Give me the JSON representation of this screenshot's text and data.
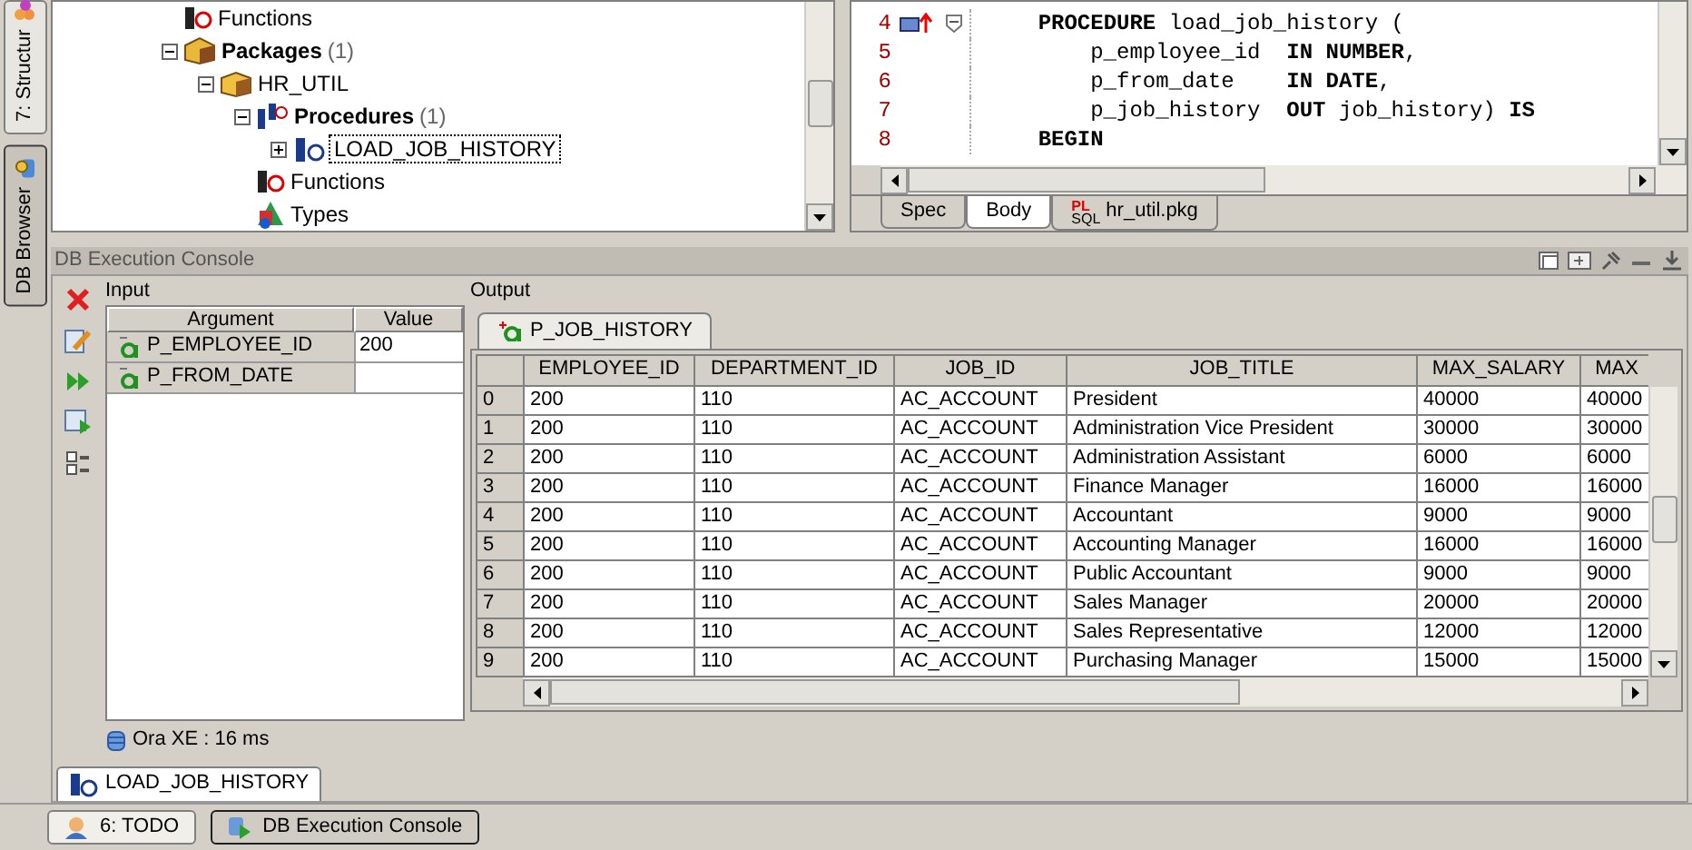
{
  "side_tabs": [
    {
      "label": "7: Structur",
      "selected": false
    },
    {
      "label": "DB Browser",
      "selected": true
    }
  ],
  "tree": [
    {
      "label": "Functions",
      "kind": "functions",
      "selected": false
    },
    {
      "label": "Packages",
      "count": "(1)",
      "kind": "folder",
      "expanded": true,
      "selected": false,
      "children": [
        {
          "label": "HR_UTIL",
          "kind": "package",
          "expanded": true,
          "selected": false,
          "children": [
            {
              "label": "Procedures",
              "count": "(1)",
              "kind": "procedures",
              "expanded": true,
              "selected": false,
              "children": [
                {
                  "label": "LOAD_JOB_HISTORY",
                  "kind": "procedure",
                  "expanded": false,
                  "selected": true
                }
              ]
            },
            {
              "label": "Functions",
              "kind": "functions",
              "selected": false
            },
            {
              "label": "Types",
              "kind": "types",
              "selected": false
            }
          ]
        }
      ]
    }
  ],
  "editor": {
    "lines": [
      {
        "number": "4",
        "marker": true,
        "fold": true,
        "code": "    **PROCEDURE** load_job_history ("
      },
      {
        "number": "5",
        "marker": false,
        "fold": false,
        "code": "        p_employee_id  **IN NUMBER**,"
      },
      {
        "number": "6",
        "marker": false,
        "fold": false,
        "code": "        p_from_date    **IN DATE**,"
      },
      {
        "number": "7",
        "marker": false,
        "fold": false,
        "code": "        p_job_history  **OUT** job_history) **IS**"
      },
      {
        "number": "8",
        "marker": false,
        "fold": false,
        "code": "    **BEGIN**"
      }
    ],
    "tabs": [
      {
        "label": "Spec",
        "selected": false
      },
      {
        "label": "Body",
        "selected": true
      },
      {
        "label": "hr_util.pkg",
        "kind": "file",
        "badge": "PL",
        "badge_sub": "SQL",
        "selected": false
      }
    ]
  },
  "console": {
    "title": "DB Execution Console",
    "input": {
      "label": "Input",
      "columns": [
        "Argument",
        "Value"
      ],
      "rows": [
        {
          "argument": "P_EMPLOYEE_ID",
          "value": "200"
        },
        {
          "argument": "P_FROM_DATE"
        }
      ]
    },
    "output": {
      "label": "Output",
      "tabs": [
        {
          "label": "P_JOB_HISTORY",
          "selected": true
        }
      ],
      "columns": [
        "EMPLOYEE_ID",
        "DEPARTMENT_ID",
        "JOB_ID",
        "JOB_TITLE",
        "MAX_SALARY",
        "MAX"
      ],
      "rows": [
        {
          "index": "0",
          "cells": [
            "200",
            "110",
            "AC_ACCOUNT",
            "President",
            "40000",
            "40000"
          ]
        },
        {
          "index": "1",
          "cells": [
            "200",
            "110",
            "AC_ACCOUNT",
            "Administration Vice President",
            "30000",
            "30000"
          ]
        },
        {
          "index": "2",
          "cells": [
            "200",
            "110",
            "AC_ACCOUNT",
            "Administration Assistant",
            "6000",
            "6000"
          ]
        },
        {
          "index": "3",
          "cells": [
            "200",
            "110",
            "AC_ACCOUNT",
            "Finance Manager",
            "16000",
            "16000"
          ]
        },
        {
          "index": "4",
          "cells": [
            "200",
            "110",
            "AC_ACCOUNT",
            "Accountant",
            "9000",
            "9000"
          ]
        },
        {
          "index": "5",
          "cells": [
            "200",
            "110",
            "AC_ACCOUNT",
            "Accounting Manager",
            "16000",
            "16000"
          ]
        },
        {
          "index": "6",
          "cells": [
            "200",
            "110",
            "AC_ACCOUNT",
            "Public Accountant",
            "9000",
            "9000"
          ]
        },
        {
          "index": "7",
          "cells": [
            "200",
            "110",
            "AC_ACCOUNT",
            "Sales Manager",
            "20000",
            "20000"
          ]
        },
        {
          "index": "8",
          "cells": [
            "200",
            "110",
            "AC_ACCOUNT",
            "Sales Representative",
            "12000",
            "12000"
          ]
        },
        {
          "index": "9",
          "cells": [
            "200",
            "110",
            "AC_ACCOUNT",
            "Purchasing Manager",
            "15000",
            "15000"
          ]
        }
      ]
    },
    "status": "Ora XE : 16 ms",
    "tabs": [
      {
        "label": "LOAD_JOB_HISTORY",
        "selected": true
      }
    ]
  },
  "tool_buttons": [
    {
      "label": "6: TODO",
      "selected": false
    },
    {
      "label": "DB Execution Console",
      "selected": true
    }
  ]
}
